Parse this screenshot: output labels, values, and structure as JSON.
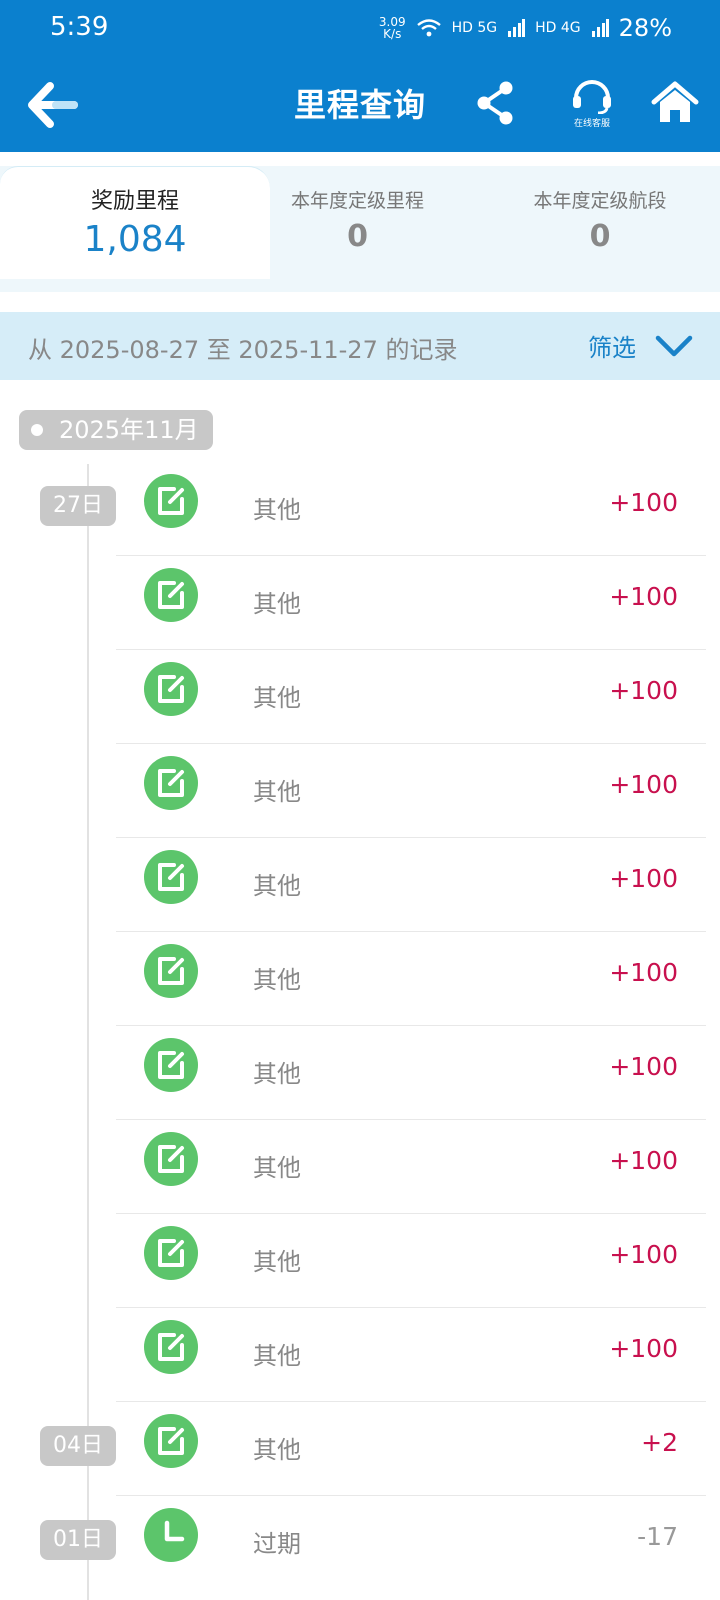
{
  "status_bar": {
    "time": "5:39",
    "speed_value": "3.09",
    "speed_unit": "K/s",
    "network_1": "HD 5G",
    "network_2": "HD 4G",
    "battery": "28%"
  },
  "header": {
    "title": "里程查询",
    "support_label": "在线客服"
  },
  "tabs": [
    {
      "label": "奖励里程",
      "value": "1,084"
    },
    {
      "label": "本年度定级里程",
      "value": "0"
    },
    {
      "label": "本年度定级航段",
      "value": "0"
    }
  ],
  "filter": {
    "range_text": "从 2025-08-27 至 2025-11-27 的记录",
    "button_label": "筛选"
  },
  "month_label": "2025年11月",
  "records": [
    {
      "day": "27日",
      "icon": "edit-icon",
      "label": "其他",
      "value": "+100"
    },
    {
      "day": "",
      "icon": "edit-icon",
      "label": "其他",
      "value": "+100"
    },
    {
      "day": "",
      "icon": "edit-icon",
      "label": "其他",
      "value": "+100"
    },
    {
      "day": "",
      "icon": "edit-icon",
      "label": "其他",
      "value": "+100"
    },
    {
      "day": "",
      "icon": "edit-icon",
      "label": "其他",
      "value": "+100"
    },
    {
      "day": "",
      "icon": "edit-icon",
      "label": "其他",
      "value": "+100"
    },
    {
      "day": "",
      "icon": "edit-icon",
      "label": "其他",
      "value": "+100"
    },
    {
      "day": "",
      "icon": "edit-icon",
      "label": "其他",
      "value": "+100"
    },
    {
      "day": "",
      "icon": "edit-icon",
      "label": "其他",
      "value": "+100"
    },
    {
      "day": "",
      "icon": "edit-icon",
      "label": "其他",
      "value": "+100"
    },
    {
      "day": "04日",
      "icon": "edit-icon",
      "label": "其他",
      "value": "+2"
    },
    {
      "day": "01日",
      "icon": "clock-icon",
      "label": "过期",
      "value": "-17"
    }
  ],
  "colors": {
    "brand_blue": "#0b80ce",
    "positive_value": "#c8104e",
    "icon_green": "#5cc56b"
  }
}
